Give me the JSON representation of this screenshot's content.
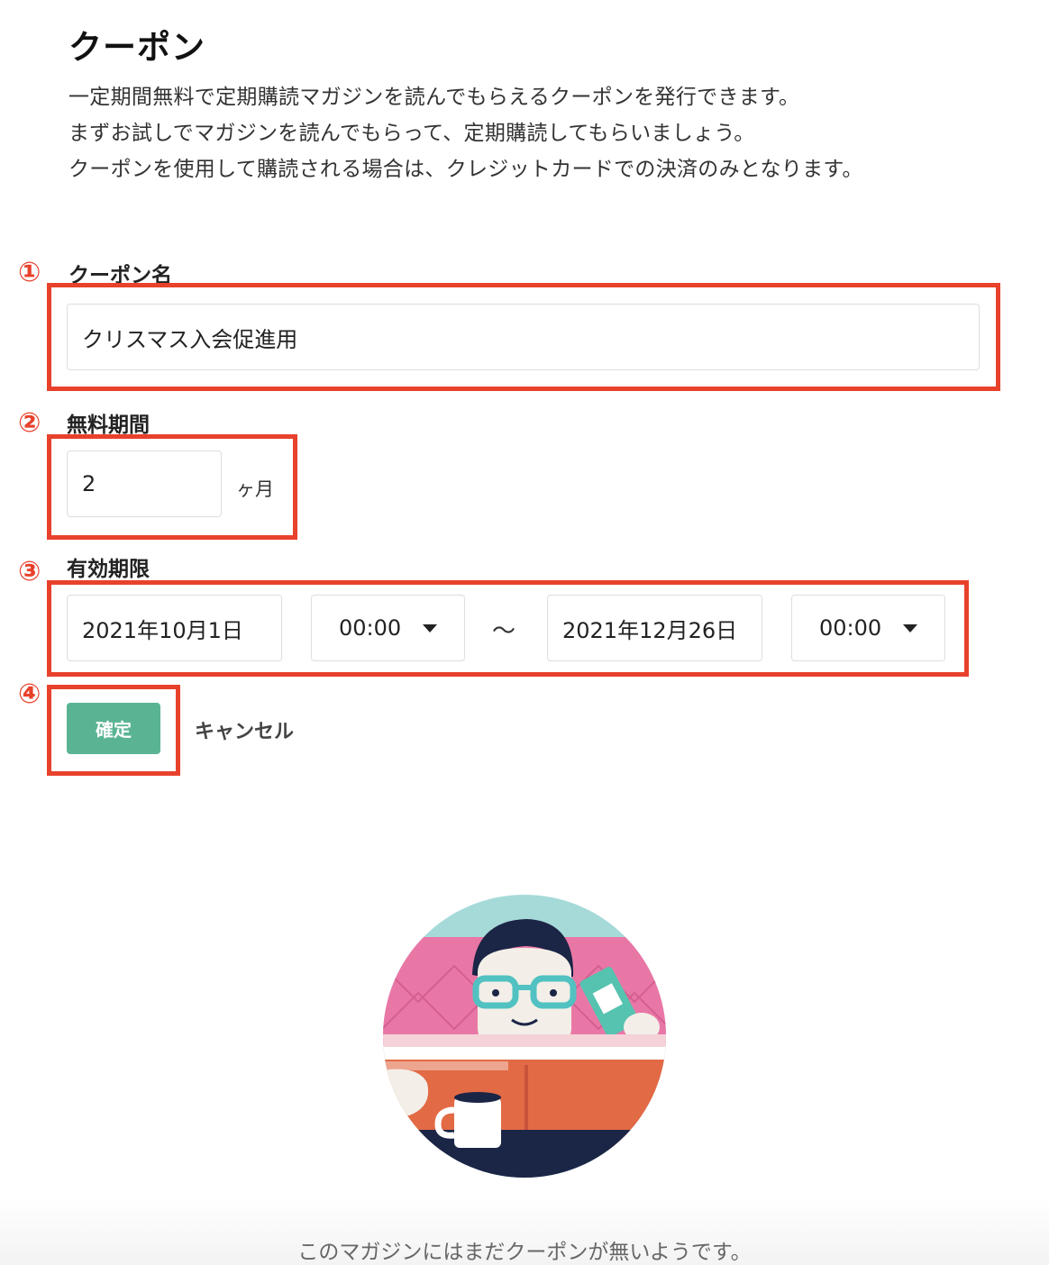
{
  "title": "クーポン",
  "description": [
    "一定期間無料で定期購読マガジンを読んでもらえるクーポンを発行できます。",
    "まずお試しでマガジンを読んでもらって、定期購読してもらいましょう。",
    "クーポンを使用して購読される場合は、クレジットカードでの決済のみとなります。"
  ],
  "markers": [
    "①",
    "②",
    "③",
    "④"
  ],
  "form": {
    "coupon_name": {
      "label": "クーポン名",
      "value": "クリスマス入会促進用"
    },
    "free_period": {
      "label": "無料期間",
      "value": "2",
      "unit": "ヶ月"
    },
    "validity": {
      "label": "有効期限",
      "start_date": "2021年10月1日",
      "start_time": "00:00",
      "separator": "〜",
      "end_date": "2021年12月26日",
      "end_time": "00:00"
    },
    "confirm_label": "確定",
    "cancel_label": "キャンセル"
  },
  "annotation_color": "#e8412c",
  "accent_color": "#5ab493",
  "empty_message": "このマガジンにはまだクーポンが無いようです。"
}
